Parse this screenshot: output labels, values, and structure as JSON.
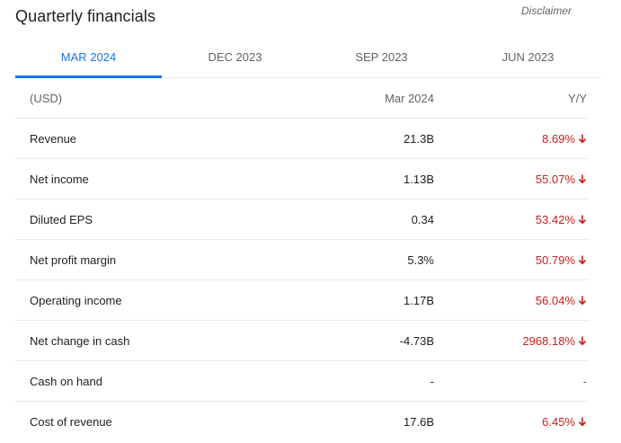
{
  "header": {
    "title": "Quarterly financials",
    "disclaimer": "Disclaimer"
  },
  "tabs": [
    {
      "label": "MAR 2024",
      "active": true
    },
    {
      "label": "DEC 2023",
      "active": false
    },
    {
      "label": "SEP 2023",
      "active": false
    },
    {
      "label": "JUN 2023",
      "active": false
    }
  ],
  "table": {
    "columns": {
      "label": "(USD)",
      "value": "Mar 2024",
      "change": "Y/Y"
    },
    "rows": [
      {
        "label": "Revenue",
        "value": "21.3B",
        "change": "8.69%",
        "direction": "down"
      },
      {
        "label": "Net income",
        "value": "1.13B",
        "change": "55.07%",
        "direction": "down"
      },
      {
        "label": "Diluted EPS",
        "value": "0.34",
        "change": "53.42%",
        "direction": "down"
      },
      {
        "label": "Net profit margin",
        "value": "5.3%",
        "change": "50.79%",
        "direction": "down"
      },
      {
        "label": "Operating income",
        "value": "1.17B",
        "change": "56.04%",
        "direction": "down"
      },
      {
        "label": "Net change in cash",
        "value": "-4.73B",
        "change": "2968.18%",
        "direction": "down"
      },
      {
        "label": "Cash on hand",
        "value": "-",
        "change": "-",
        "direction": "none"
      },
      {
        "label": "Cost of revenue",
        "value": "17.6B",
        "change": "6.45%",
        "direction": "down"
      }
    ]
  },
  "colors": {
    "accent": "#1a73e8",
    "negative": "#c5221f",
    "muted": "#5f6368",
    "divider": "#e8eaed"
  },
  "icons": {
    "down": "arrow-down-icon"
  }
}
